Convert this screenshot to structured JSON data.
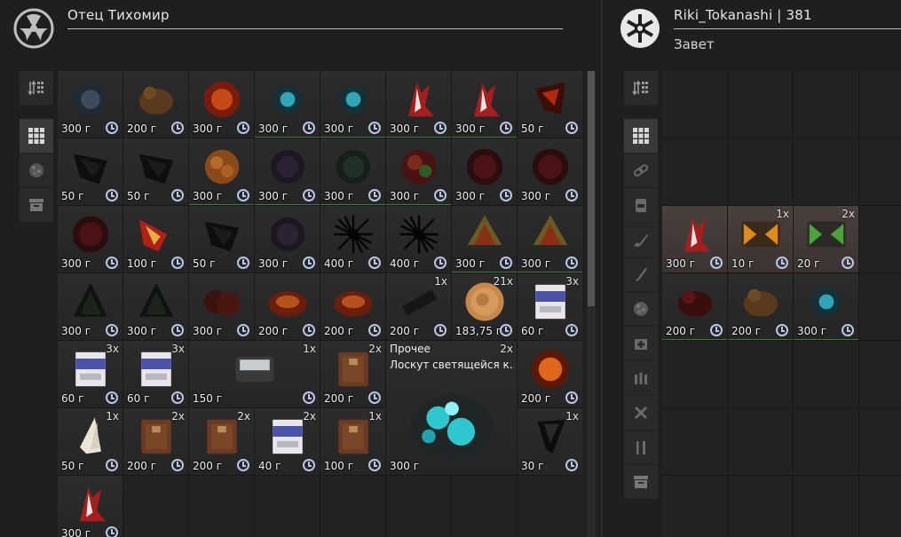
{
  "left_panel": {
    "title": "Отец Тихомир",
    "icon": "radiation-icon"
  },
  "right_panel": {
    "title": "Riki_Tokanashi | 381",
    "subtitle": "Завет",
    "icon": "faction-emblem-icon"
  },
  "colors": {
    "green_underline": "#3f7a3a",
    "clock": "#b9c7e4",
    "highlight_cell": "#4a3f3c"
  },
  "left_items": [
    {
      "price": "300 г",
      "qty": "",
      "art": "dark-blue-artifact"
    },
    {
      "price": "200 г",
      "qty": "",
      "art": "brown-rock-artifact"
    },
    {
      "price": "300 г",
      "qty": "",
      "art": "fiery-orange-artifact"
    },
    {
      "price": "300 г",
      "qty": "",
      "art": "teal-glow-artifact",
      "green": true
    },
    {
      "price": "300 г",
      "qty": "",
      "art": "teal-glow-artifact",
      "green": true
    },
    {
      "price": "300 г",
      "qty": "",
      "art": "red-crystal-artifact",
      "green": true
    },
    {
      "price": "300 г",
      "qty": "",
      "art": "red-crystal-artifact",
      "green": true
    },
    {
      "price": "50 г",
      "qty": "",
      "art": "lava-shard-artifact"
    },
    {
      "price": "50 г",
      "qty": "",
      "art": "black-shard-artifact"
    },
    {
      "price": "50 г",
      "qty": "",
      "art": "black-shard-artifact"
    },
    {
      "price": "300 г",
      "qty": "",
      "art": "amber-blob-artifact",
      "green": true
    },
    {
      "price": "300 г",
      "qty": "",
      "art": "dark-violet-artifact",
      "green": true
    },
    {
      "price": "300 г",
      "qty": "",
      "art": "dark-green-artifact",
      "green": true
    },
    {
      "price": "300 г",
      "qty": "",
      "art": "red-moss-artifact",
      "green": true
    },
    {
      "price": "300 г",
      "qty": "",
      "art": "crimson-orb-artifact"
    },
    {
      "price": "300 г",
      "qty": "",
      "art": "crimson-orb-artifact"
    },
    {
      "price": "300 г",
      "qty": "",
      "art": "crimson-orb-artifact"
    },
    {
      "price": "100 г",
      "qty": "",
      "art": "gold-red-shard-artifact"
    },
    {
      "price": "50 г",
      "qty": "",
      "art": "black-shard-artifact"
    },
    {
      "price": "300 г",
      "qty": "",
      "art": "dark-violet-artifact"
    },
    {
      "price": "400 г",
      "qty": "",
      "art": "black-spike-artifact"
    },
    {
      "price": "400 г",
      "qty": "",
      "art": "black-spike-artifact"
    },
    {
      "price": "300 г",
      "qty": "",
      "art": "olive-shell-artifact",
      "green": true
    },
    {
      "price": "300 г",
      "qty": "",
      "art": "olive-shell-artifact",
      "green": true
    },
    {
      "price": "300 г",
      "qty": "",
      "art": "dark-shell-artifact"
    },
    {
      "price": "300 г",
      "qty": "",
      "art": "dark-shell-artifact"
    },
    {
      "price": "300 г",
      "qty": "",
      "art": "red-coral-artifact"
    },
    {
      "price": "200 г",
      "qty": "",
      "art": "orange-coral-artifact"
    },
    {
      "price": "200 г",
      "qty": "",
      "art": "orange-coral-artifact"
    },
    {
      "price": "200 г",
      "qty": "1x",
      "art": "black-bar-item"
    },
    {
      "price": "183,75 г",
      "qty": "21x",
      "art": "gold-coin-item"
    },
    {
      "price": "60 г",
      "qty": "3x",
      "art": "cigarette-pack-item"
    },
    {
      "price": "60 г",
      "qty": "3x",
      "art": "cigarette-pack-item"
    },
    {
      "price": "60 г",
      "qty": "3x",
      "art": "cigarette-pack-item"
    },
    {
      "price": "150 г",
      "qty": "1x",
      "art": "metal-container-item",
      "wide": true
    },
    {
      "price": "200 г",
      "qty": "2x",
      "art": "leather-book-item"
    },
    {
      "price": "300 г",
      "qty": "2x",
      "art": "glowing-cloth-item",
      "big": true,
      "category": "Прочее",
      "name": "Лоскут светящейся к..."
    },
    {
      "price": "200 г",
      "qty": "",
      "art": "orange-sun-artifact"
    },
    {
      "price": "50 г",
      "qty": "1x",
      "art": "claw-item"
    },
    {
      "price": "200 г",
      "qty": "2x",
      "art": "leather-book-item"
    },
    {
      "price": "200 г",
      "qty": "2x",
      "art": "leather-book-item"
    },
    {
      "price": "40 г",
      "qty": "2x",
      "art": "cigarette-pack-item"
    },
    {
      "price": "100 г",
      "qty": "1x",
      "art": "leather-book-item"
    },
    {
      "price": "30 г",
      "qty": "1x",
      "art": "black-fang-item"
    },
    {
      "price": "300 г",
      "qty": "",
      "art": "red-crystal-artifact"
    }
  ],
  "right_items": [
    {
      "price": "300 г",
      "qty": "",
      "art": "red-crystal-artifact",
      "hl": true
    },
    {
      "price": "10 г",
      "qty": "1x",
      "art": "orange-case-item",
      "hl": true
    },
    {
      "price": "20 г",
      "qty": "2x",
      "art": "green-case-item",
      "hl": true
    },
    {
      "price": "200 г",
      "qty": "",
      "art": "dark-red-rock-artifact",
      "green": true
    },
    {
      "price": "200 г",
      "qty": "",
      "art": "brown-rock-artifact",
      "green": true
    },
    {
      "price": "300 г",
      "qty": "",
      "art": "teal-glow-artifact",
      "green": true
    }
  ]
}
